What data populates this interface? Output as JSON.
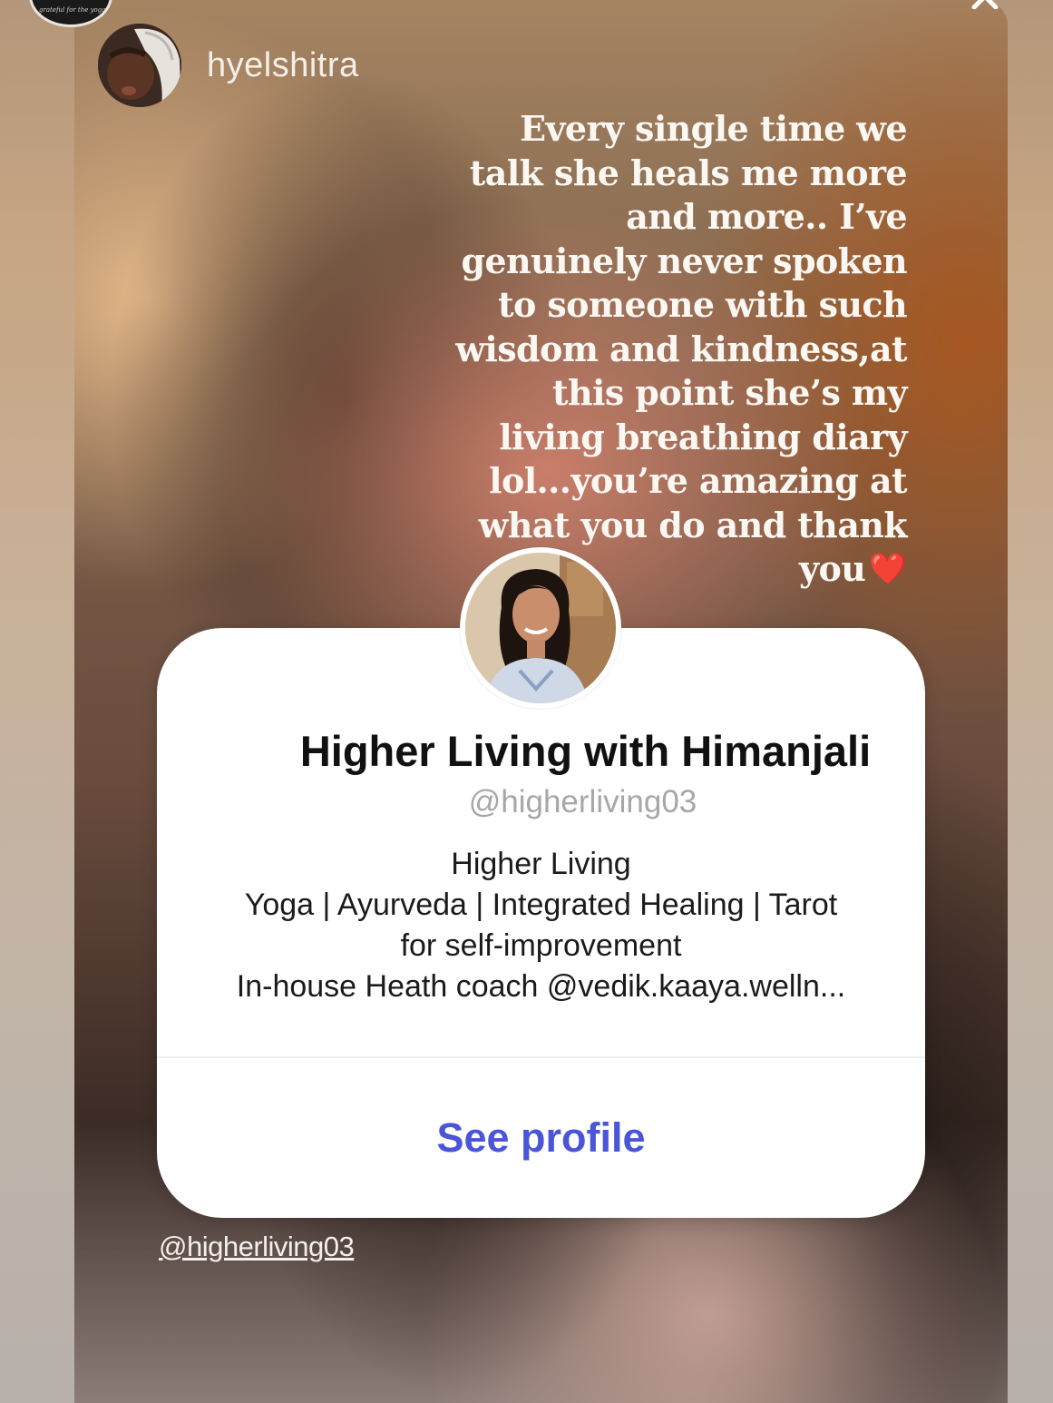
{
  "story": {
    "poster_username": "hyelshitra",
    "top_avatar_text": "grateful for the yoga",
    "caption_lines": [
      "Every single time we",
      "talk she heals me more",
      "and more.. I’ve",
      "genuinely never spoken",
      "to someone with such",
      "wisdom and kindness,at",
      "this point she’s my",
      "living breathing diary",
      "lol...you’re amazing at",
      "what you do and thank",
      "you"
    ],
    "heart_emoji": "❤️",
    "mention_tag": "@higherliving03"
  },
  "profile_card": {
    "name": "Higher Living with Himanjali",
    "handle": "@higherliving03",
    "bio_lines": [
      "Higher Living",
      "Yoga | Ayurveda | Integrated Healing | Tarot",
      "for self-improvement",
      "In-house Heath coach @vedik.kaaya.welln..."
    ],
    "cta_label": "See profile",
    "cta_color": "#4a55d8"
  },
  "icons": {
    "close": "close-icon",
    "avatar": "avatar"
  }
}
